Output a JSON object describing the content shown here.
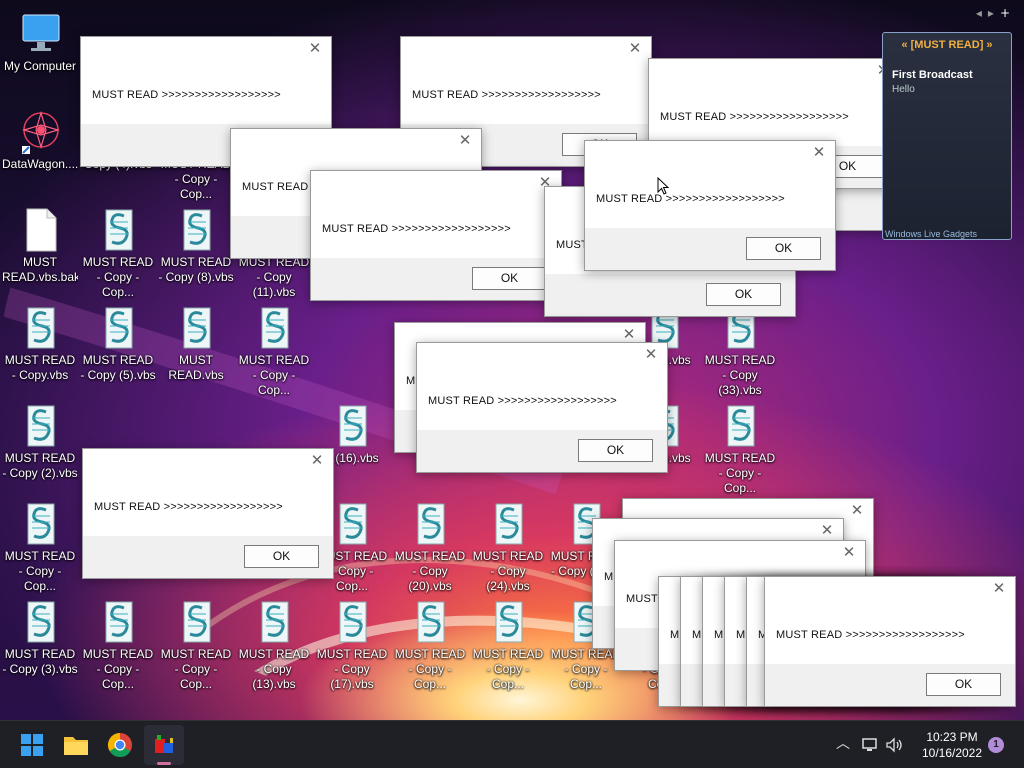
{
  "desktop": {
    "icons": [
      {
        "label": "My Computer",
        "type": "computer"
      },
      {
        "label": "DataWagon....",
        "type": "datawagon"
      },
      {
        "label": "MUST READ.vbs.bak",
        "type": "blank"
      },
      {
        "label": "MUST READ - Copy.vbs",
        "type": "script"
      },
      {
        "label": "MUST READ - Copy (2).vbs",
        "type": "script"
      },
      {
        "label": "MUST READ - Copy - Cop...",
        "type": "script"
      },
      {
        "label": "MUST READ - Copy (3).vbs",
        "type": "script"
      },
      {
        "label": "Copy (4).vbs",
        "type": "script"
      },
      {
        "label": "MUST READ - Copy - Cop...",
        "type": "script"
      },
      {
        "label": "MUST READ - Copy - Cop...",
        "type": "script"
      },
      {
        "label": "MUST READ - Copy (5).vbs",
        "type": "script"
      },
      {
        "label": "MUST READ - Copy (8).vbs",
        "type": "script"
      },
      {
        "label": "MUST READ.vbs",
        "type": "script"
      },
      {
        "label": "MUST READ - Copy (11).vbs",
        "type": "script"
      },
      {
        "label": "MUST READ - Copy - Cop...",
        "type": "script"
      },
      {
        "label": "MUST READ - Copy (13).vbs",
        "type": "script"
      },
      {
        "label": "MUST READ - Copy - Cop...",
        "type": "script"
      },
      {
        "label": "MUST READ - Copy - Cop...",
        "type": "script"
      },
      {
        "label": "...(16).vbs",
        "type": "script"
      },
      {
        "label": "MUST READ - Copy - Cop...",
        "type": "script"
      },
      {
        "label": "MUST READ - Copy (17).vbs",
        "type": "script"
      },
      {
        "label": "MUST READ - Copy (20).vbs",
        "type": "script"
      },
      {
        "label": "MUST READ - Copy - Cop...",
        "type": "script"
      },
      {
        "label": "MUST READ - Copy (24).vbs",
        "type": "script"
      },
      {
        "label": "MUST READ - Copy - Cop...",
        "type": "script"
      },
      {
        "label": "MUST READ - Copy (27)...",
        "type": "script"
      },
      {
        "label": "MUST READ - Copy - Cop...",
        "type": "script"
      },
      {
        "label": "MUST READ - Copy (33).vbs",
        "type": "script"
      },
      {
        "label": "MUST READ - Copy - Cop...",
        "type": "script"
      },
      {
        "label": "...(30).vbs",
        "type": "script"
      },
      {
        "label": "...(29).vbs",
        "type": "script"
      },
      {
        "label": "MUST READ - Copy - Cop...",
        "type": "script"
      }
    ]
  },
  "dialogs": [
    {
      "message": "MUST READ >>>>>>>>>>>>>>>>>>",
      "ok": "OK"
    },
    {
      "message": "MUST READ >>>>>>>>>>>>>>>>>>",
      "ok": "OK"
    },
    {
      "message": "MUST READ >>>>>>>>>>>>>>>>>>",
      "ok": "OK"
    },
    {
      "message": "MUST READ >>>>>>>>>>>>>>>>>>",
      "ok": "OK"
    },
    {
      "message": "MUST READ >>>>>>>>>>>>>>>>>>",
      "ok": "OK"
    },
    {
      "message": "MUST READ >>>>>>>>>>>>>>>>>>",
      "ok": "OK"
    },
    {
      "message": "MUST READ >>>>>>>>>>>>>>>>>>",
      "ok": "OK"
    },
    {
      "message": "MUST READ >>>>>>>>>>>>>>>>>>",
      "ok": "OK"
    },
    {
      "message": "MUST READ >>>>>>>>>>>>>>>>>>",
      "ok": "OK"
    },
    {
      "message": "MUST READ >>>>>>>>>>>>>>>>>>",
      "ok": "OK"
    },
    {
      "message": "MUST READ >>>>>>>>>>>>>>>>>>",
      "ok": "OK"
    },
    {
      "message": "MUST READ >>>>>>>>>>>>>>>>>>",
      "ok": "OK"
    },
    {
      "message": "MUST READ >>>>>>>>>>>>>>>>>>",
      "ok": "OK"
    },
    {
      "message": "MUST READ >>>>>>>>>>>>>>>>>>",
      "ok": "OK"
    },
    {
      "message": "MUST READ >>>>>>>>>>>>>>>>>>",
      "ok": "OK"
    },
    {
      "message": "MUST READ >>>>>>>>>>>>>>>>>>",
      "ok": "OK"
    },
    {
      "message": "MUST READ >>>>>>>>>>>>>>>>>>",
      "ok": "OK"
    },
    {
      "message": "MUST READ >>>>>>>>>>>>>>>>>>",
      "ok": "OK"
    },
    {
      "message": "MUST READ >>>>>>>>>>>>>>>>>>",
      "ok": "OK"
    },
    {
      "message": "MUST READ >>>>>>>>>>>>>>>>>>",
      "ok": "OK"
    }
  ],
  "broadcast_widget": {
    "header": "[MUST READ]",
    "prev_icon": "double-chevron-left",
    "next_icon": "double-chevron-right",
    "title": "First Broadcast",
    "body": "Hello",
    "footer": "Windows Live Gadgets"
  },
  "top_nav": {
    "icons": [
      "back-arrow",
      "forward-arrow",
      "plus"
    ]
  },
  "taskbar": {
    "apps": [
      "start",
      "file-explorer",
      "chrome",
      "script-runner"
    ],
    "tray_icons": [
      "chevron-up",
      "network",
      "volume"
    ],
    "time": "10:23 PM",
    "date": "10/16/2022",
    "notification_count": "1",
    "notification_color": "#b18cd9"
  }
}
